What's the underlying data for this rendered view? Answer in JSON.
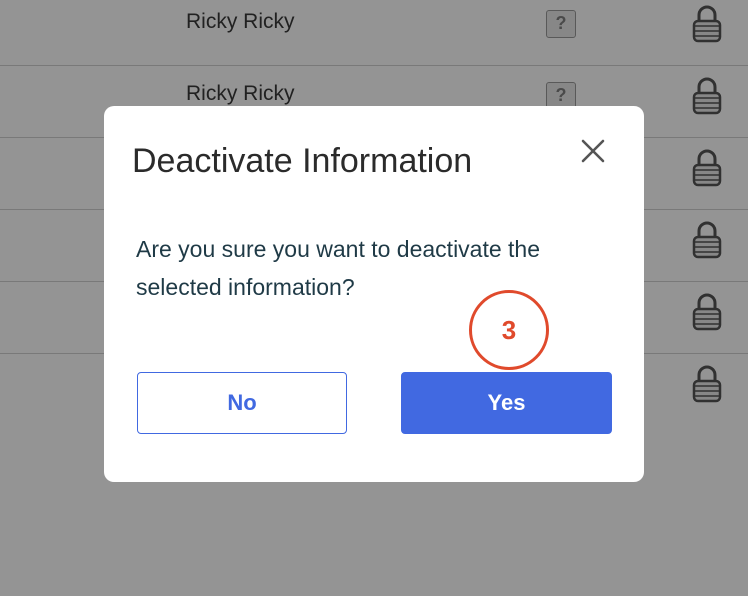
{
  "table": {
    "rows": [
      {
        "name": "Ricky Ricky",
        "help": "?"
      },
      {
        "name": "Ricky Ricky",
        "help": "?"
      },
      {
        "name": "",
        "help": ""
      },
      {
        "name": "",
        "help": ""
      },
      {
        "name": "",
        "help": ""
      },
      {
        "name": "",
        "help": ""
      }
    ]
  },
  "dialog": {
    "title": "Deactivate Information",
    "message": "Are you sure you want to deactivate the selected information?",
    "no_label": "No",
    "yes_label": "Yes",
    "close_icon": "close-icon"
  },
  "annotation": {
    "step_number": "3"
  },
  "colors": {
    "primary": "#4169e1",
    "annotation": "#e04a2c",
    "overlay": "rgba(0,0,0,0.42)"
  }
}
